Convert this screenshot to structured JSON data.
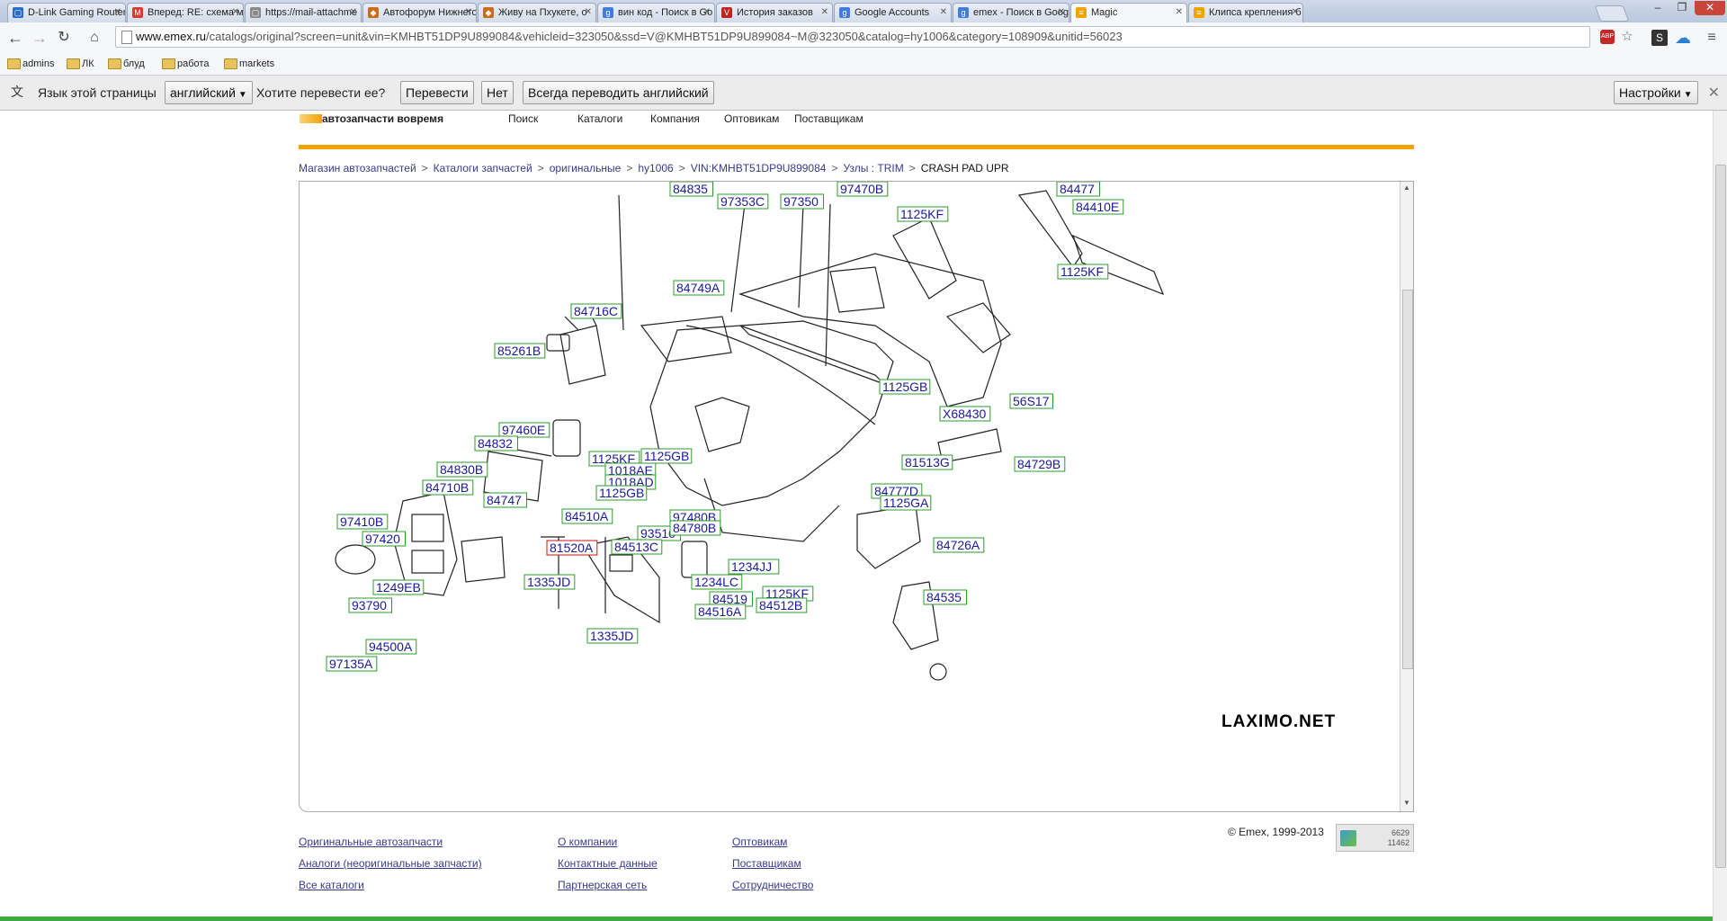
{
  "tabs": [
    {
      "title": "D-Link Gaming Router",
      "color": "#2a6ac8",
      "glyph": "▢"
    },
    {
      "title": "Вперед: RE: схема м",
      "color": "#d93a2e",
      "glyph": "M"
    },
    {
      "title": "https://mail-attachme",
      "color": "#888888",
      "glyph": "▢"
    },
    {
      "title": "Автофорум Нижнего",
      "color": "#cc6b1b",
      "glyph": "◆"
    },
    {
      "title": "Живу на Пхукете, о",
      "color": "#cc6b1b",
      "glyph": "◆"
    },
    {
      "title": "вин код - Поиск в Go",
      "color": "#3f7ee0",
      "glyph": "g"
    },
    {
      "title": "История заказов",
      "color": "#c0261e",
      "glyph": "V"
    },
    {
      "title": "Google Accounts",
      "color": "#3f7ee0",
      "glyph": "g"
    },
    {
      "title": "emex - Поиск в Goog",
      "color": "#3f7ee0",
      "glyph": "g"
    },
    {
      "title": "Magic",
      "color": "#f0a400",
      "glyph": "≡"
    },
    {
      "title": "Клипса крепления б",
      "color": "#f0a400",
      "glyph": "≡"
    }
  ],
  "active_tab_index": 9,
  "url": {
    "host": "www.emex.ru",
    "path": "/catalogs/original?screen=unit&vin=KMHBT51DP9U899084&vehicleid=323050&ssd=V@KMHBT51DP9U899084~M@323050&catalog=hy1006&category=108909&unitid=56023"
  },
  "omnibox_icons": {
    "abp": "ABP",
    "star": "☆"
  },
  "bookmarks": [
    "admins",
    "ЛК",
    "блуд",
    "работа",
    "markets"
  ],
  "translate_bar": {
    "label": "Язык этой страницы",
    "language": "английский",
    "question": "Хотите перевести ее?",
    "translate": "Перевести",
    "no": "Нет",
    "always": "Всегда переводить английский",
    "settings": "Настройки"
  },
  "site_header": {
    "slogan": "автозапчасти вовремя",
    "nav": [
      "Поиск",
      "Каталоги",
      "Компания",
      "Оптовикам",
      "Поставщикам"
    ]
  },
  "breadcrumb": {
    "links": [
      "Магазин автозапчастей",
      "Каталоги запчастей",
      "оригинальные",
      "hy1006",
      "VIN:KMHBT51DP9U899084",
      "Узлы : TRIM"
    ],
    "current": "CRASH PAD UPR",
    "separator": ">"
  },
  "diagram": {
    "callouts": [
      "84835",
      "97353C",
      "97350",
      "97470B",
      "1125KF",
      "84477",
      "84410E",
      "1125KF",
      "84749A",
      "84716C",
      "85261B",
      "1125GB",
      "56S17",
      "X68430",
      "97460E",
      "84832",
      "1125KF",
      "1125GB",
      "81513G",
      "84729B",
      "84830B",
      "1018AE",
      "1018AD",
      "1125GB",
      "84777D",
      "84710B",
      "84747",
      "84510A",
      "1125GA",
      "97410B",
      "97420",
      "93510",
      "97480B",
      "84780B",
      "81520A",
      "84513C",
      "84726A",
      "1335JD",
      "1234JJ",
      "1249EB",
      "1234LC",
      "1125KF",
      "84519",
      "84512B",
      "93790",
      "84516A",
      "84535",
      "94500A",
      "1335JD",
      "97135A"
    ],
    "highlighted": "81520A",
    "watermark": "LAXIMO.NET"
  },
  "footer": {
    "col1": [
      "Оригинальные автозапчасти",
      "Аналоги (неоригинальные запчасти)",
      "Все каталоги"
    ],
    "col2": [
      "О компании",
      "Контактные данные",
      "Партнерская сеть"
    ],
    "col3": [
      "Оптовикам",
      "Поставщикам",
      "Сотрудничество"
    ],
    "copyright": "© Emex, 1999-2013",
    "counter": [
      "6629",
      "11462"
    ]
  }
}
